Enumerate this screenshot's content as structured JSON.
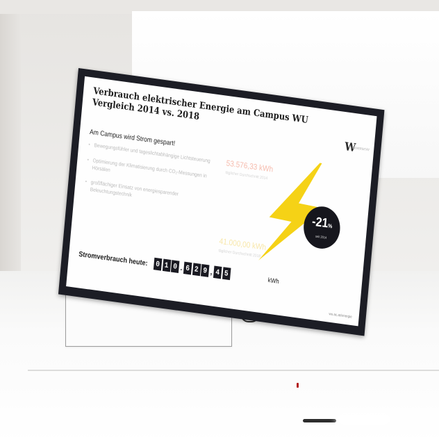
{
  "display": {
    "title_line1": "Verbrauch elektrischer Energie am Campus WU",
    "title_line2": "Vergleich 2014 vs. 2018",
    "logo": "W",
    "logo_text": "UNIVERSITÄT",
    "subtitle": "Am Campus wird Strom gespart!",
    "bullets": [
      "Bewegungsfühler und tageslichtabhängige Lichtsteuerung",
      "Optimierung der Klimatisierung durch CO₂-Messungen in Hörsälen",
      "großflächiger Einsatz von energiesparender Beleuchtungstechnik"
    ],
    "stat1_value": "53.576,33 kWh",
    "stat1_label": "täglicher Durchschnitt 2014",
    "stat2_value": "41.000,00 kWh",
    "stat2_label": "täglicher Durchschnitt 2018",
    "badge_value": "-21",
    "badge_unit": "%",
    "badge_note": "seit 2014",
    "counter_label": "Stromverbrauch heute:",
    "counter_digits": [
      "0",
      "1",
      "0",
      ".",
      "6",
      "2",
      "9",
      ",",
      "4",
      "5"
    ],
    "counter_unit": "kWh",
    "footer_url": "wu.ac.at/energie"
  },
  "colors": {
    "bolt": "#f5d216",
    "stat1": "#f6bcae",
    "stat2": "#f8e7a9",
    "frame": "#1c1d25"
  }
}
